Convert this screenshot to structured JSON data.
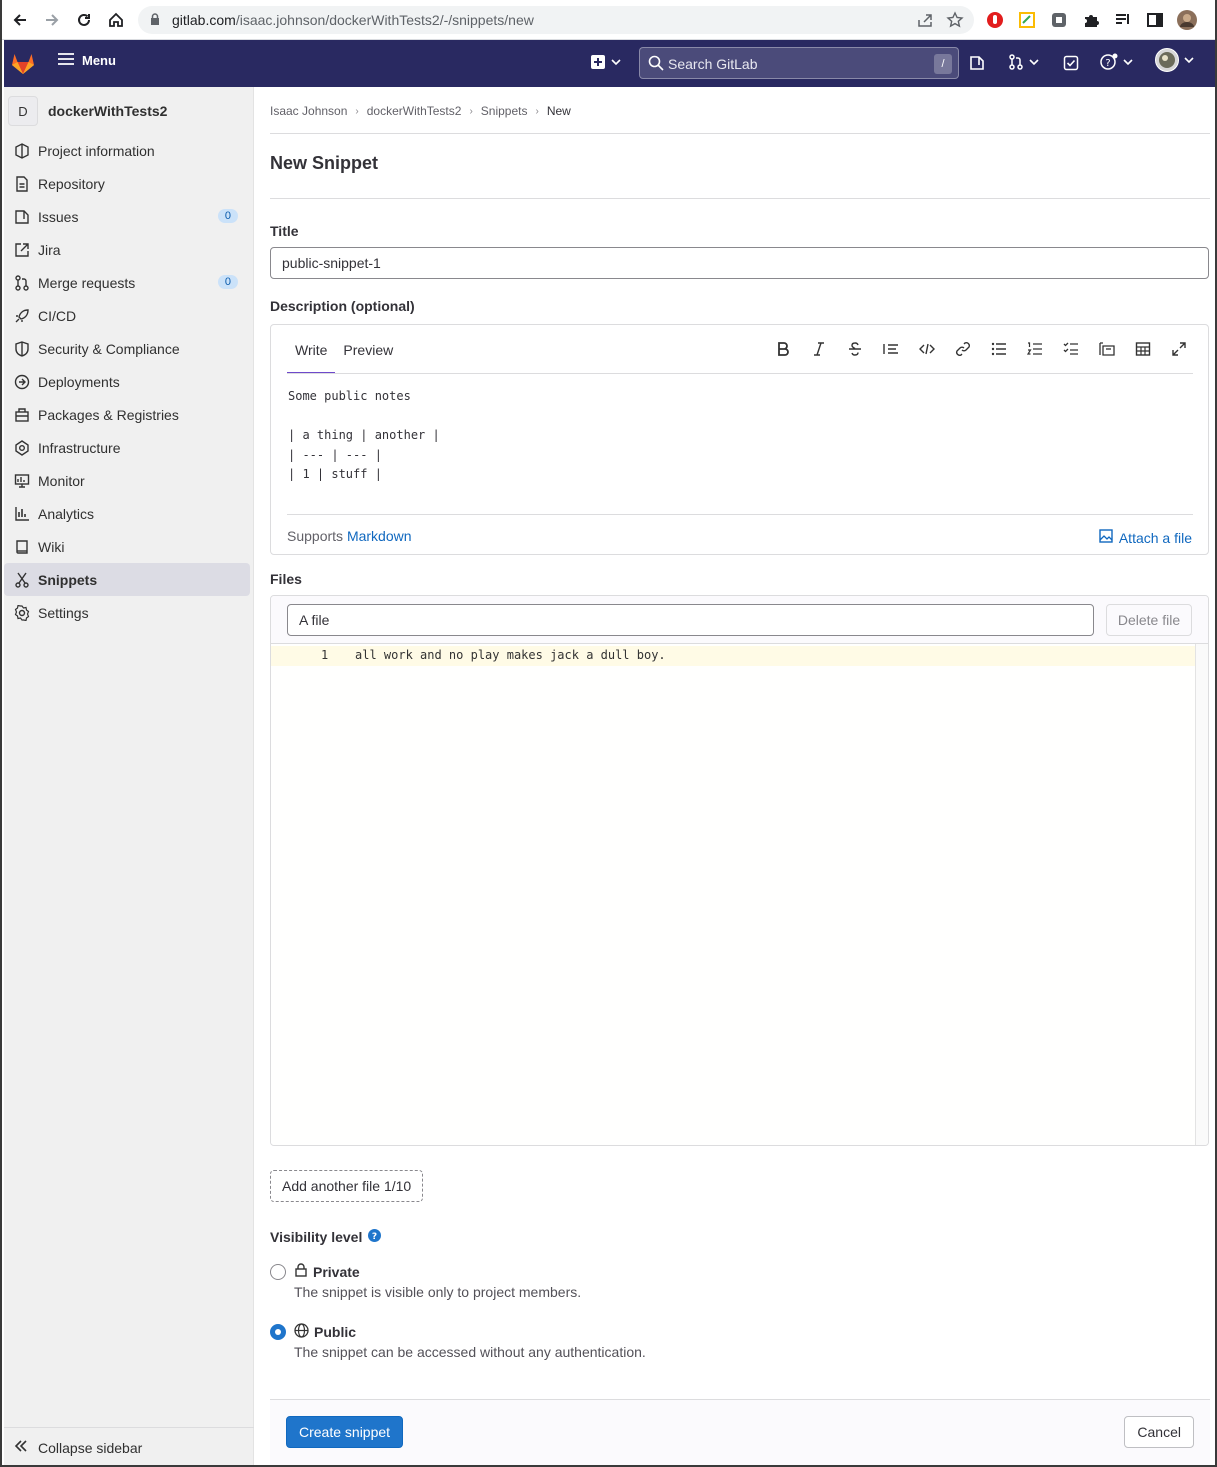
{
  "browser": {
    "url_host": "gitlab.com",
    "url_path": "/isaac.johnson/dockerWithTests2/-/snippets/new"
  },
  "header": {
    "menu_label": "Menu",
    "search_placeholder": "Search GitLab",
    "search_shortcut": "/"
  },
  "sidebar": {
    "project_initial": "D",
    "project_name": "dockerWithTests2",
    "items": [
      {
        "label": "Project information",
        "icon": "project-icon"
      },
      {
        "label": "Repository",
        "icon": "doc-icon"
      },
      {
        "label": "Issues",
        "icon": "issues-icon",
        "badge": "0"
      },
      {
        "label": "Jira",
        "icon": "external-link-icon"
      },
      {
        "label": "Merge requests",
        "icon": "merge-request-icon",
        "badge": "0"
      },
      {
        "label": "CI/CD",
        "icon": "rocket-icon"
      },
      {
        "label": "Security & Compliance",
        "icon": "shield-icon"
      },
      {
        "label": "Deployments",
        "icon": "deployments-icon"
      },
      {
        "label": "Packages & Registries",
        "icon": "package-icon"
      },
      {
        "label": "Infrastructure",
        "icon": "cloud-gear-icon"
      },
      {
        "label": "Monitor",
        "icon": "monitor-icon"
      },
      {
        "label": "Analytics",
        "icon": "chart-icon"
      },
      {
        "label": "Wiki",
        "icon": "book-icon"
      },
      {
        "label": "Snippets",
        "icon": "snippet-icon",
        "active": true
      },
      {
        "label": "Settings",
        "icon": "gear-icon"
      }
    ],
    "collapse_label": "Collapse sidebar"
  },
  "breadcrumbs": [
    "Isaac Johnson",
    "dockerWithTests2",
    "Snippets",
    "New"
  ],
  "page_title": "New Snippet",
  "form": {
    "title_label": "Title",
    "title_value": "public-snippet-1",
    "description_label": "Description (optional)",
    "tab_write": "Write",
    "tab_preview": "Preview",
    "description_text": "Some public notes\n\n| a thing | another |\n| --- | --- |\n| 1 | stuff |",
    "supports_prefix": "Supports",
    "markdown_link": "Markdown",
    "attach_label": "Attach a file",
    "files_label": "Files",
    "file_name": "A file",
    "delete_file_label": "Delete file",
    "code_line_number": "1",
    "code_line": "all work and no play makes jack a dull boy.",
    "add_file_label": "Add another file 1/10",
    "visibility_label": "Visibility level",
    "visibility_options": [
      {
        "label": "Private",
        "description": "The snippet is visible only to project members.",
        "selected": false
      },
      {
        "label": "Public",
        "description": "The snippet can be accessed without any authentication.",
        "selected": true
      }
    ],
    "create_label": "Create snippet",
    "cancel_label": "Cancel"
  },
  "colors": {
    "header_bg": "#292961",
    "primary": "#1f75cb",
    "tab_active": "#6e49cb"
  }
}
